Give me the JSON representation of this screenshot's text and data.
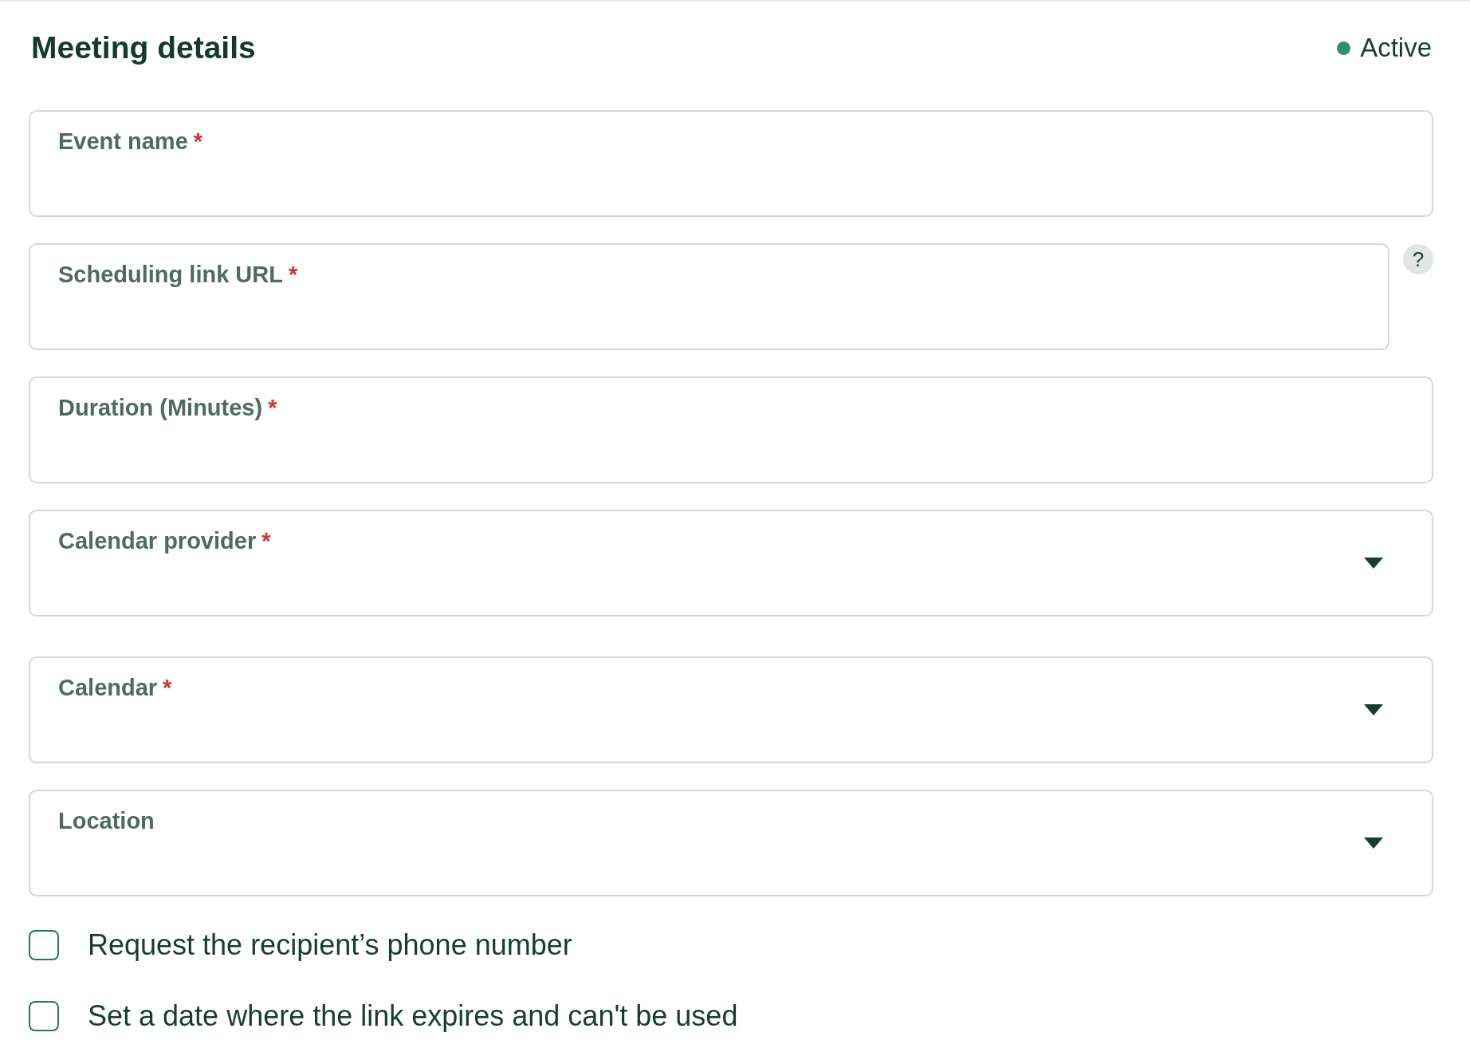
{
  "header": {
    "title": "Meeting details",
    "status": {
      "label": "Active",
      "color": "#2e8f72"
    }
  },
  "fields": [
    {
      "kind": "text",
      "label": "Event name",
      "required_mark": "*"
    },
    {
      "kind": "text",
      "label": "Scheduling link URL",
      "required_mark": "*",
      "help": "?"
    },
    {
      "kind": "text",
      "label": "Duration (Minutes)",
      "required_mark": "*"
    },
    {
      "kind": "select",
      "label": "Calendar provider",
      "required_mark": "*"
    },
    {
      "kind": "select",
      "label": "Calendar",
      "required_mark": "*"
    },
    {
      "kind": "select",
      "label": "Location"
    }
  ],
  "checkboxes": [
    {
      "label": "Request the recipient’s phone number",
      "checked": false
    },
    {
      "label": "Set a date where the link expires and can't be used",
      "checked": false
    }
  ]
}
